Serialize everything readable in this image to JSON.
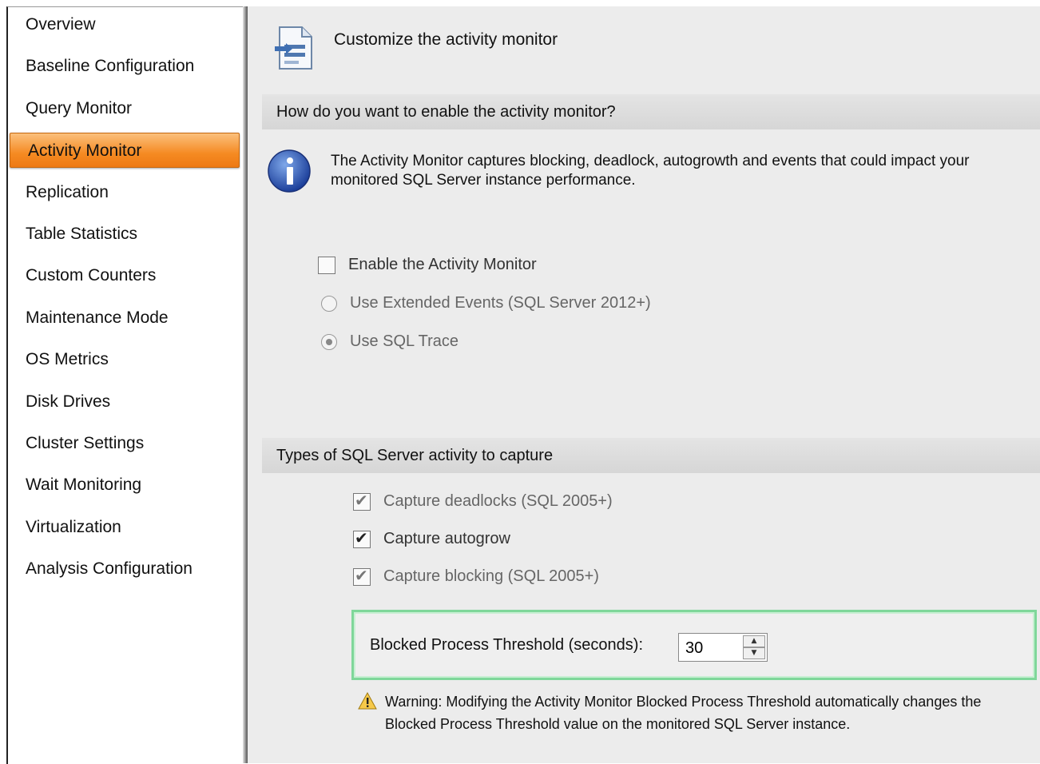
{
  "sidebar": {
    "items": [
      {
        "label": "Overview",
        "active": false
      },
      {
        "label": "Baseline Configuration",
        "active": false
      },
      {
        "label": "Query Monitor",
        "active": false
      },
      {
        "label": "Activity Monitor",
        "active": true
      },
      {
        "label": "Replication",
        "active": false
      },
      {
        "label": "Table Statistics",
        "active": false
      },
      {
        "label": "Custom Counters",
        "active": false
      },
      {
        "label": "Maintenance Mode",
        "active": false
      },
      {
        "label": "OS Metrics",
        "active": false
      },
      {
        "label": "Disk Drives",
        "active": false
      },
      {
        "label": "Cluster Settings",
        "active": false
      },
      {
        "label": "Wait Monitoring",
        "active": false
      },
      {
        "label": "Virtualization",
        "active": false
      },
      {
        "label": "Analysis Configuration",
        "active": false
      }
    ]
  },
  "header": {
    "title": "Customize the activity monitor",
    "icon": "document-edit-icon"
  },
  "section1": {
    "title": "How do you want to enable the activity monitor?",
    "info_text": "The Activity Monitor captures blocking, deadlock, autogrowth and events that could impact your monitored SQL Server instance performance.",
    "options": [
      {
        "type": "checkbox",
        "label": "Enable the Activity Monitor",
        "checked": false,
        "disabled": false
      },
      {
        "type": "radio",
        "label": "Use Extended Events (SQL Server 2012+)",
        "checked": false,
        "disabled": true
      },
      {
        "type": "radio",
        "label": "Use SQL Trace",
        "checked": true,
        "disabled": true
      }
    ]
  },
  "section2": {
    "title": "Types of SQL Server activity to capture",
    "options": [
      {
        "label": "Capture deadlocks (SQL 2005+)",
        "checked": true,
        "disabled": true
      },
      {
        "label": "Capture autogrow",
        "checked": true,
        "disabled": false
      },
      {
        "label": "Capture blocking (SQL 2005+)",
        "checked": true,
        "disabled": true
      }
    ]
  },
  "threshold": {
    "label": "Blocked Process Threshold (seconds):",
    "value": "30"
  },
  "warning": {
    "text": "Warning: Modifying the Activity Monitor Blocked Process Threshold automatically changes the Blocked Process Threshold value on the monitored SQL Server instance."
  }
}
